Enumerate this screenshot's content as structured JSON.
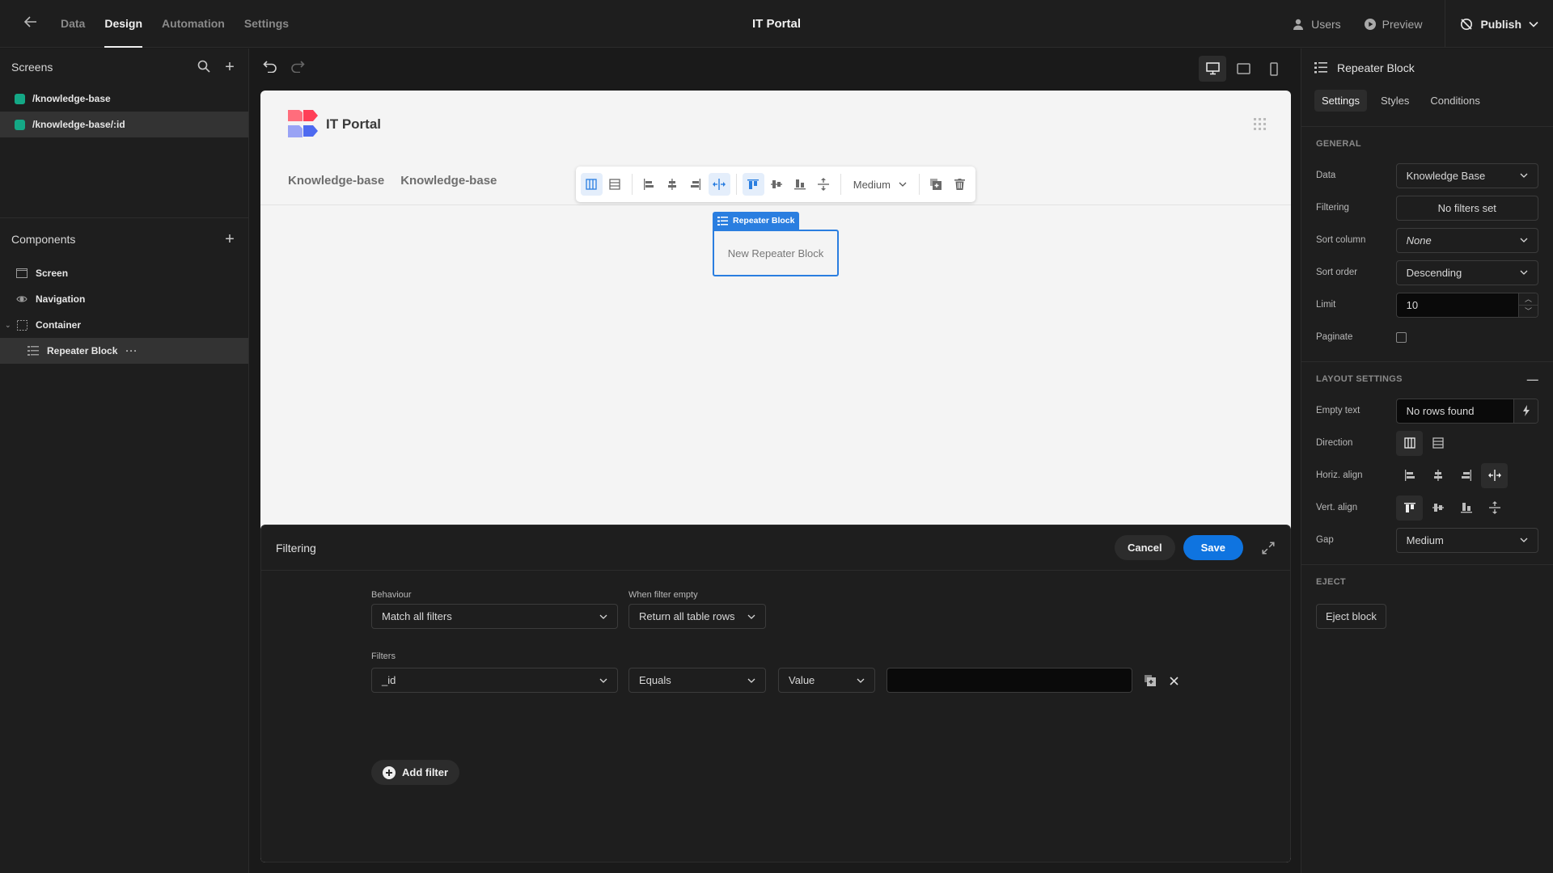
{
  "topbar": {
    "back_icon": "arrow-left-icon",
    "tabs": [
      {
        "label": "Data",
        "active": false
      },
      {
        "label": "Design",
        "active": true
      },
      {
        "label": "Automation",
        "active": false
      },
      {
        "label": "Settings",
        "active": false
      }
    ],
    "app_title": "IT Portal",
    "users_label": "Users",
    "preview_label": "Preview",
    "publish_label": "Publish"
  },
  "left": {
    "screens_title": "Screens",
    "screens": [
      {
        "path": "/knowledge-base",
        "selected": false
      },
      {
        "path": "/knowledge-base/:id",
        "selected": true
      }
    ],
    "components_title": "Components",
    "components": [
      {
        "label": "Screen",
        "icon": "screen-icon"
      },
      {
        "label": "Navigation",
        "icon": "eye-icon"
      },
      {
        "label": "Container",
        "icon": "container-icon"
      },
      {
        "label": "Repeater Block",
        "icon": "list-icon",
        "selected": true
      }
    ]
  },
  "canvas": {
    "site_title": "IT Portal",
    "nav_links": [
      "Knowledge-base",
      "Knowledge-base"
    ],
    "toolbar_gap": "Medium",
    "selected_tag": "Repeater Block",
    "placeholder": "New Repeater Block",
    "accent": "#2a7ee0"
  },
  "drawer": {
    "title": "Filtering",
    "cancel": "Cancel",
    "save": "Save",
    "behaviour_label": "Behaviour",
    "behaviour_value": "Match all filters",
    "empty_label": "When filter empty",
    "empty_value": "Return all table rows",
    "filters_label": "Filters",
    "filter": {
      "field": "_id",
      "operator": "Equals",
      "type": "Value",
      "value": ""
    },
    "add_filter": "Add filter"
  },
  "right": {
    "component_title": "Repeater Block",
    "tabs": [
      {
        "label": "Settings",
        "active": true
      },
      {
        "label": "Styles",
        "active": false
      },
      {
        "label": "Conditions",
        "active": false
      }
    ],
    "general_title": "GENERAL",
    "data_label": "Data",
    "data_value": "Knowledge Base",
    "filtering_label": "Filtering",
    "filtering_value": "No filters set",
    "sort_column_label": "Sort column",
    "sort_column_value": "None",
    "sort_order_label": "Sort order",
    "sort_order_value": "Descending",
    "limit_label": "Limit",
    "limit_value": "10",
    "paginate_label": "Paginate",
    "paginate_checked": false,
    "layout_title": "LAYOUT SETTINGS",
    "empty_text_label": "Empty text",
    "empty_text_value": "No rows found",
    "direction_label": "Direction",
    "horiz_label": "Horiz. align",
    "vert_label": "Vert. align",
    "gap_label": "Gap",
    "gap_value": "Medium",
    "eject_title": "EJECT",
    "eject_button": "Eject block",
    "save_color": "#0f74e0",
    "screen_dot_color": "#14a886"
  }
}
